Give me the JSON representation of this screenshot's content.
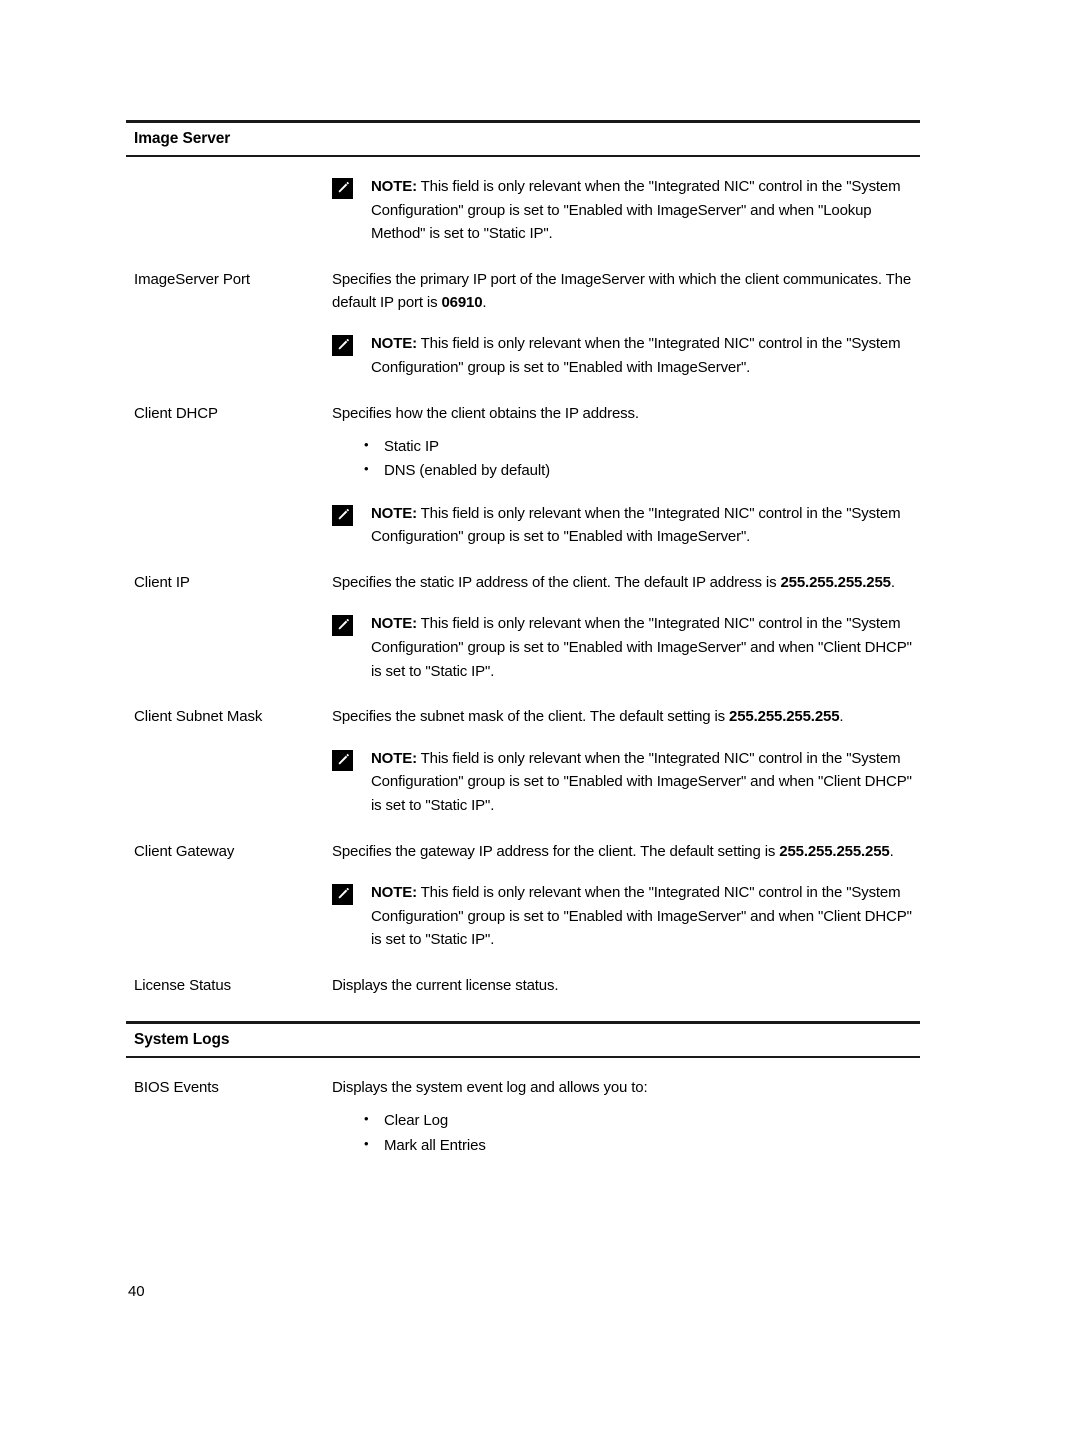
{
  "page": {
    "number": "40"
  },
  "sections": [
    {
      "id": "image-server",
      "heading": "Image Server",
      "rows": [
        {
          "type": "note",
          "icon": "note-pencil-icon",
          "label_bold": "NOTE:",
          "text": " This field is only relevant when the \"Integrated NIC\" control in the \"System Configuration\" group is set to \"Enabled with ImageServer\" and when \"Lookup Method\" is set to \"Static IP\"."
        },
        {
          "type": "row",
          "label": "ImageServer Port",
          "text_before": "Specifies the primary IP port of the ImageServer with which the client communicates. The default IP port is ",
          "bold_value": "06910",
          "text_after": "."
        },
        {
          "type": "note",
          "icon": "note-pencil-icon",
          "label_bold": "NOTE:",
          "text": " This field is only relevant when the \"Integrated NIC\" control in the \"System Configuration\" group is set to \"Enabled with ImageServer\"."
        },
        {
          "type": "row",
          "label": "Client DHCP",
          "text_before": "Specifies how the client obtains the IP address.",
          "bold_value": "",
          "text_after": "",
          "bullets": [
            "Static IP",
            "DNS (enabled by default)"
          ]
        },
        {
          "type": "note",
          "icon": "note-pencil-icon",
          "label_bold": "NOTE:",
          "text": " This field is only relevant when the \"Integrated NIC\" control in the \"System Configuration\" group is set to \"Enabled with ImageServer\"."
        },
        {
          "type": "row",
          "label": "Client IP",
          "text_before": "Specifies the static IP address of the client. The default IP address is ",
          "bold_value": "255.255.255.255",
          "text_after": "."
        },
        {
          "type": "note",
          "icon": "note-pencil-icon",
          "label_bold": "NOTE:",
          "text": " This field is only relevant when the \"Integrated NIC\" control in the \"System Configuration\" group is set to \"Enabled with ImageServer\" and when \"Client DHCP\" is set to \"Static IP\"."
        },
        {
          "type": "row",
          "label": "Client Subnet Mask",
          "text_before": "Specifies the subnet mask of the client. The default setting is ",
          "bold_value": "255.255.255.255",
          "text_after": "."
        },
        {
          "type": "note",
          "icon": "note-pencil-icon",
          "label_bold": "NOTE:",
          "text": " This field is only relevant when the \"Integrated NIC\" control in the \"System Configuration\" group is set to \"Enabled with ImageServer\" and when \"Client DHCP\" is set to \"Static IP\"."
        },
        {
          "type": "row",
          "label": "Client Gateway",
          "text_before": "Specifies the gateway IP address for the client. The default setting is ",
          "bold_value": "255.255.255.255",
          "text_after": "."
        },
        {
          "type": "note",
          "icon": "note-pencil-icon",
          "label_bold": "NOTE:",
          "text": " This field is only relevant when the \"Integrated NIC\" control in the \"System Configuration\" group is set to \"Enabled with ImageServer\" and when \"Client DHCP\" is set to \"Static IP\"."
        },
        {
          "type": "row",
          "label": "License Status",
          "text_before": "Displays the current license status.",
          "bold_value": "",
          "text_after": ""
        }
      ]
    },
    {
      "id": "system-logs",
      "heading": "System Logs",
      "rows": [
        {
          "type": "row",
          "label": "BIOS Events",
          "text_before": "Displays the system event log and allows you to:",
          "bold_value": "",
          "text_after": "",
          "bullets": [
            "Clear Log",
            "Mark all Entries"
          ]
        }
      ]
    }
  ]
}
